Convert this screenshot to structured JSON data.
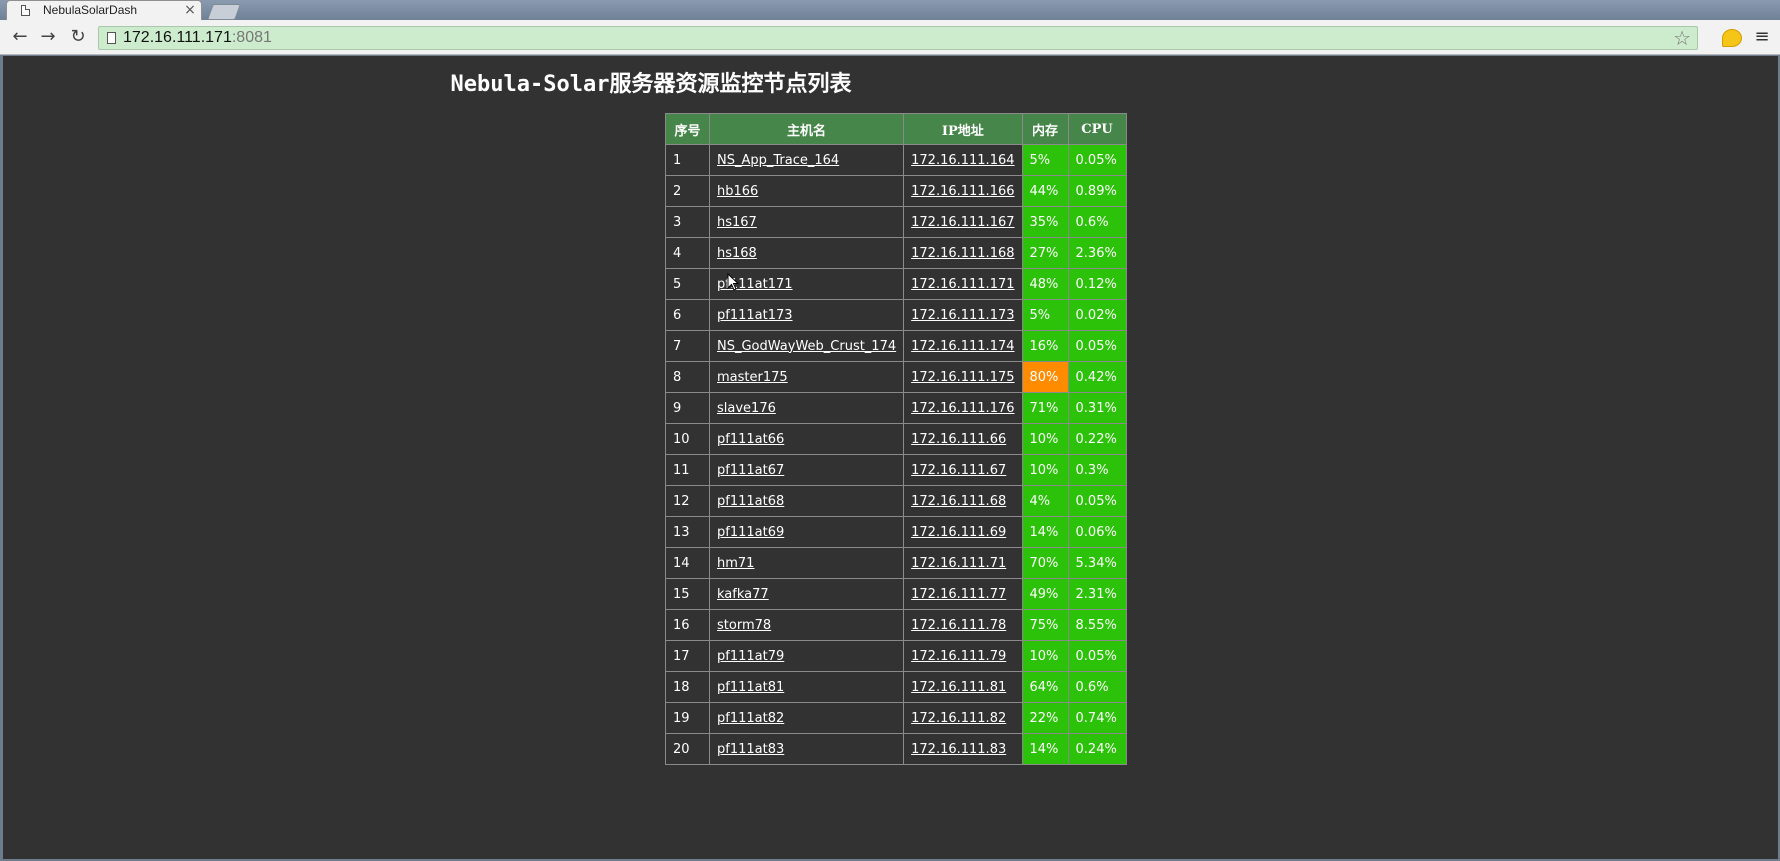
{
  "browser": {
    "tab_title": "NebulaSolarDash",
    "url_host": "172.16.111.171",
    "url_port": ":8081"
  },
  "page": {
    "title": "Nebula-Solar服务器资源监控节点列表",
    "columns": [
      "序号",
      "主机名",
      "IP地址",
      "内存",
      "CPU"
    ],
    "rows": [
      {
        "idx": "1",
        "host": "NS_App_Trace_164",
        "ip": "172.16.111.164",
        "mem": "5%",
        "cpu": "0.05%",
        "mem_status": "ok"
      },
      {
        "idx": "2",
        "host": "hb166",
        "ip": "172.16.111.166",
        "mem": "44%",
        "cpu": "0.89%",
        "mem_status": "ok"
      },
      {
        "idx": "3",
        "host": "hs167",
        "ip": "172.16.111.167",
        "mem": "35%",
        "cpu": "0.6%",
        "mem_status": "ok"
      },
      {
        "idx": "4",
        "host": "hs168",
        "ip": "172.16.111.168",
        "mem": "27%",
        "cpu": "2.36%",
        "mem_status": "ok"
      },
      {
        "idx": "5",
        "host": "pf111at171",
        "ip": "172.16.111.171",
        "mem": "48%",
        "cpu": "0.12%",
        "mem_status": "ok"
      },
      {
        "idx": "6",
        "host": "pf111at173",
        "ip": "172.16.111.173",
        "mem": "5%",
        "cpu": "0.02%",
        "mem_status": "ok"
      },
      {
        "idx": "7",
        "host": "NS_GodWayWeb_Crust_174",
        "ip": "172.16.111.174",
        "mem": "16%",
        "cpu": "0.05%",
        "mem_status": "ok"
      },
      {
        "idx": "8",
        "host": "master175",
        "ip": "172.16.111.175",
        "mem": "80%",
        "cpu": "0.42%",
        "mem_status": "warn"
      },
      {
        "idx": "9",
        "host": "slave176",
        "ip": "172.16.111.176",
        "mem": "71%",
        "cpu": "0.31%",
        "mem_status": "ok"
      },
      {
        "idx": "10",
        "host": "pf111at66",
        "ip": "172.16.111.66",
        "mem": "10%",
        "cpu": "0.22%",
        "mem_status": "ok"
      },
      {
        "idx": "11",
        "host": "pf111at67",
        "ip": "172.16.111.67",
        "mem": "10%",
        "cpu": "0.3%",
        "mem_status": "ok"
      },
      {
        "idx": "12",
        "host": "pf111at68",
        "ip": "172.16.111.68",
        "mem": "4%",
        "cpu": "0.05%",
        "mem_status": "ok"
      },
      {
        "idx": "13",
        "host": "pf111at69",
        "ip": "172.16.111.69",
        "mem": "14%",
        "cpu": "0.06%",
        "mem_status": "ok"
      },
      {
        "idx": "14",
        "host": "hm71",
        "ip": "172.16.111.71",
        "mem": "70%",
        "cpu": "5.34%",
        "mem_status": "ok"
      },
      {
        "idx": "15",
        "host": "kafka77",
        "ip": "172.16.111.77",
        "mem": "49%",
        "cpu": "2.31%",
        "mem_status": "ok"
      },
      {
        "idx": "16",
        "host": "storm78",
        "ip": "172.16.111.78",
        "mem": "75%",
        "cpu": "8.55%",
        "mem_status": "ok"
      },
      {
        "idx": "17",
        "host": "pf111at79",
        "ip": "172.16.111.79",
        "mem": "10%",
        "cpu": "0.05%",
        "mem_status": "ok"
      },
      {
        "idx": "18",
        "host": "pf111at81",
        "ip": "172.16.111.81",
        "mem": "64%",
        "cpu": "0.6%",
        "mem_status": "ok"
      },
      {
        "idx": "19",
        "host": "pf111at82",
        "ip": "172.16.111.82",
        "mem": "22%",
        "cpu": "0.74%",
        "mem_status": "ok"
      },
      {
        "idx": "20",
        "host": "pf111at83",
        "ip": "172.16.111.83",
        "mem": "14%",
        "cpu": "0.24%",
        "mem_status": "ok"
      }
    ]
  },
  "colors": {
    "page_background": "#323232",
    "header_background": "#47864a",
    "status_ok": "#2cc20a",
    "status_warn": "#ff8c00"
  },
  "icons": [
    "document-icon",
    "close-icon",
    "back-arrow-icon",
    "forward-arrow-icon",
    "reload-icon",
    "star-icon",
    "extension-icon",
    "menu-icon"
  ]
}
